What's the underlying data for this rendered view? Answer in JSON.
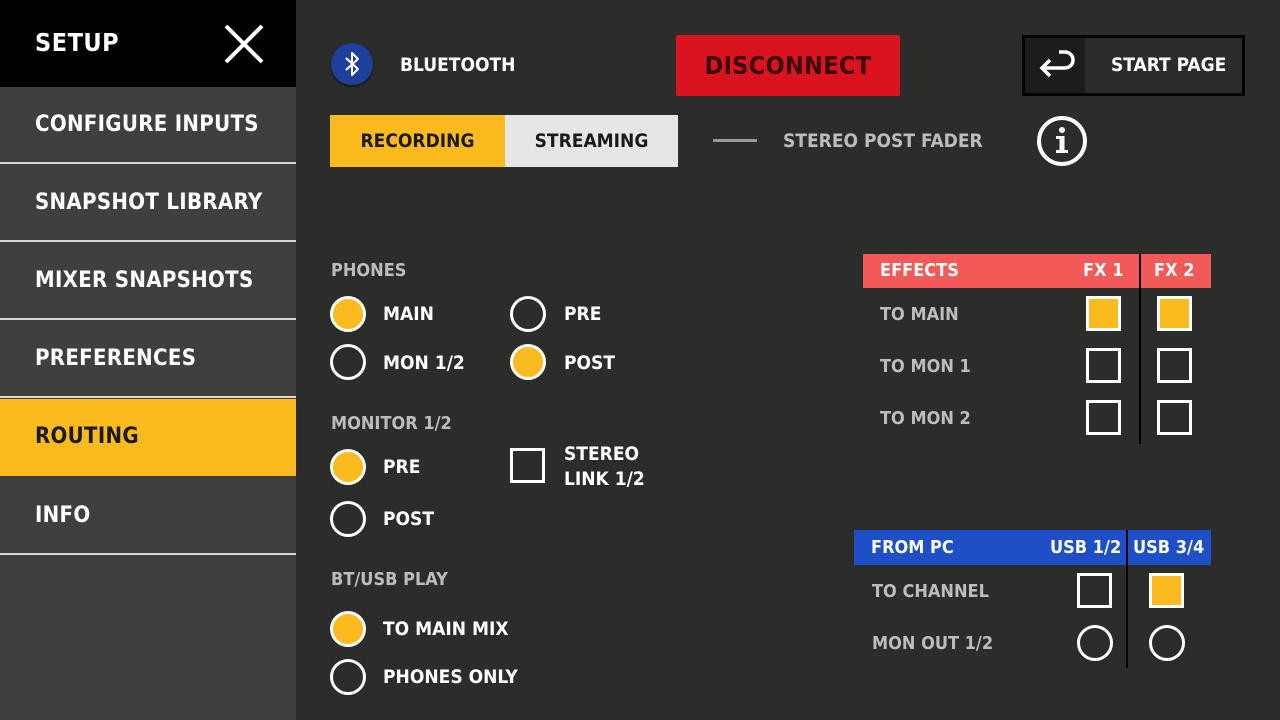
{
  "sidebar": {
    "title": "SETUP",
    "items": [
      {
        "label": "CONFIGURE INPUTS"
      },
      {
        "label": "SNAPSHOT LIBRARY"
      },
      {
        "label": "MIXER SNAPSHOTS"
      },
      {
        "label": "PREFERENCES"
      },
      {
        "label": "ROUTING"
      },
      {
        "label": "INFO"
      }
    ],
    "active": "ROUTING"
  },
  "topbar": {
    "bluetooth_label": "BLUETOOTH",
    "disconnect_label": "DISCONNECT",
    "start_page_label": "START PAGE"
  },
  "tabs": {
    "recording": "RECORDING",
    "streaming": "STREAMING",
    "active": "RECORDING"
  },
  "stereo_post_fader": "STEREO POST FADER",
  "phones": {
    "title": "PHONES",
    "main": "MAIN",
    "mon12": "MON 1/2",
    "pre": "PRE",
    "post": "POST",
    "source_selected": "MAIN",
    "tap_selected": "POST"
  },
  "monitor": {
    "title": "MONITOR 1/2",
    "pre": "PRE",
    "post": "POST",
    "selected": "PRE",
    "stereo_link_line1": "STEREO",
    "stereo_link_line2": "LINK 1/2",
    "stereo_link_checked": false
  },
  "btusb": {
    "title": "BT/USB PLAY",
    "to_main_mix": "TO MAIN MIX",
    "phones_only": "PHONES ONLY",
    "selected": "TO MAIN MIX"
  },
  "effects": {
    "header": "EFFECTS",
    "col1": "FX 1",
    "col2": "FX 2",
    "rows": [
      {
        "label": "TO MAIN",
        "fx1": true,
        "fx2": true
      },
      {
        "label": "TO MON 1",
        "fx1": false,
        "fx2": false
      },
      {
        "label": "TO MON 2",
        "fx1": false,
        "fx2": false
      }
    ]
  },
  "from_pc": {
    "header": "FROM PC",
    "col1": "USB 1/2",
    "col2": "USB 3/4",
    "rows": [
      {
        "label": "TO CHANNEL",
        "usb12": false,
        "usb34": true
      },
      {
        "label": "MON OUT 1/2",
        "usb12": false,
        "usb34": false
      }
    ]
  },
  "colors": {
    "accent": "#fbbb1f",
    "disconnect": "#d9141e",
    "effects_header": "#f25a5a",
    "from_pc_header": "#1e4fc6",
    "bluetooth": "#1f3f9c"
  },
  "icons": {
    "close": "close-icon",
    "bluetooth": "bluetooth-icon",
    "return": "return-arrow-icon",
    "info": "info-icon"
  }
}
